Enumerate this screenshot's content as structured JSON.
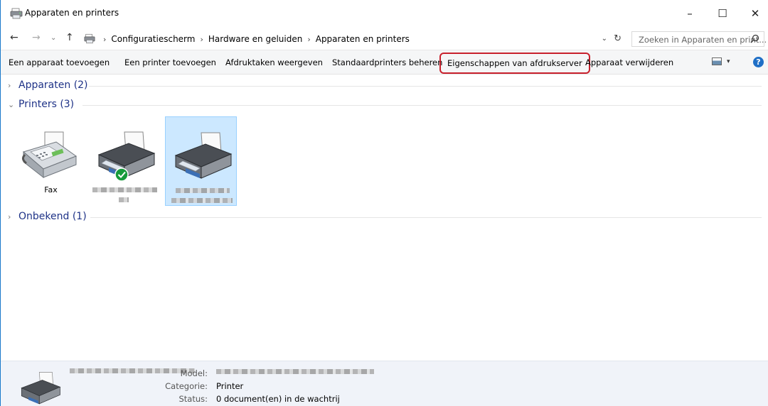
{
  "window": {
    "title": "Apparaten en printers",
    "minimize_glyph": "–",
    "maximize_glyph": "☐",
    "close_glyph": "✕"
  },
  "nav": {
    "back_glyph": "←",
    "forward_glyph": "→",
    "recent_glyph": "⌄",
    "up_glyph": "↑"
  },
  "address": {
    "breadcrumbs": [
      "Configuratiescherm",
      "Hardware en geluiden",
      "Apparaten en printers"
    ],
    "separator": "›",
    "dropdown_glyph": "⌄",
    "refresh_glyph": "↻"
  },
  "search": {
    "placeholder": "Zoeken in Apparaten en print...",
    "icon": "search-icon"
  },
  "commands": [
    "Een apparaat toevoegen",
    "Een printer toevoegen",
    "Afdruktaken weergeven",
    "Standaardprinters beheren",
    "Eigenschappen van afdrukserver",
    "Apparaat verwijderen"
  ],
  "highlight_color": "#c8202c",
  "view_dropdown_glyph": "▾",
  "help_glyph": "?",
  "groups": {
    "devices": {
      "label": "Apparaten (2)",
      "chevron": "›"
    },
    "printers": {
      "label": "Printers (3)",
      "chevron": "⌄"
    },
    "unknown": {
      "label": "Onbekend (1)",
      "chevron": "›"
    }
  },
  "printers": [
    {
      "label": "Fax",
      "kind": "fax-icon",
      "default": false,
      "selected": false
    },
    {
      "label": "",
      "kind": "printer-icon",
      "default": true,
      "selected": false
    },
    {
      "label": "",
      "kind": "printer-icon",
      "default": false,
      "selected": true
    }
  ],
  "details": {
    "model_label": "Model:",
    "category_label": "Categorie:",
    "category_value": "Printer",
    "status_label": "Status:",
    "status_value": "0 document(en) in de wachtrij"
  }
}
